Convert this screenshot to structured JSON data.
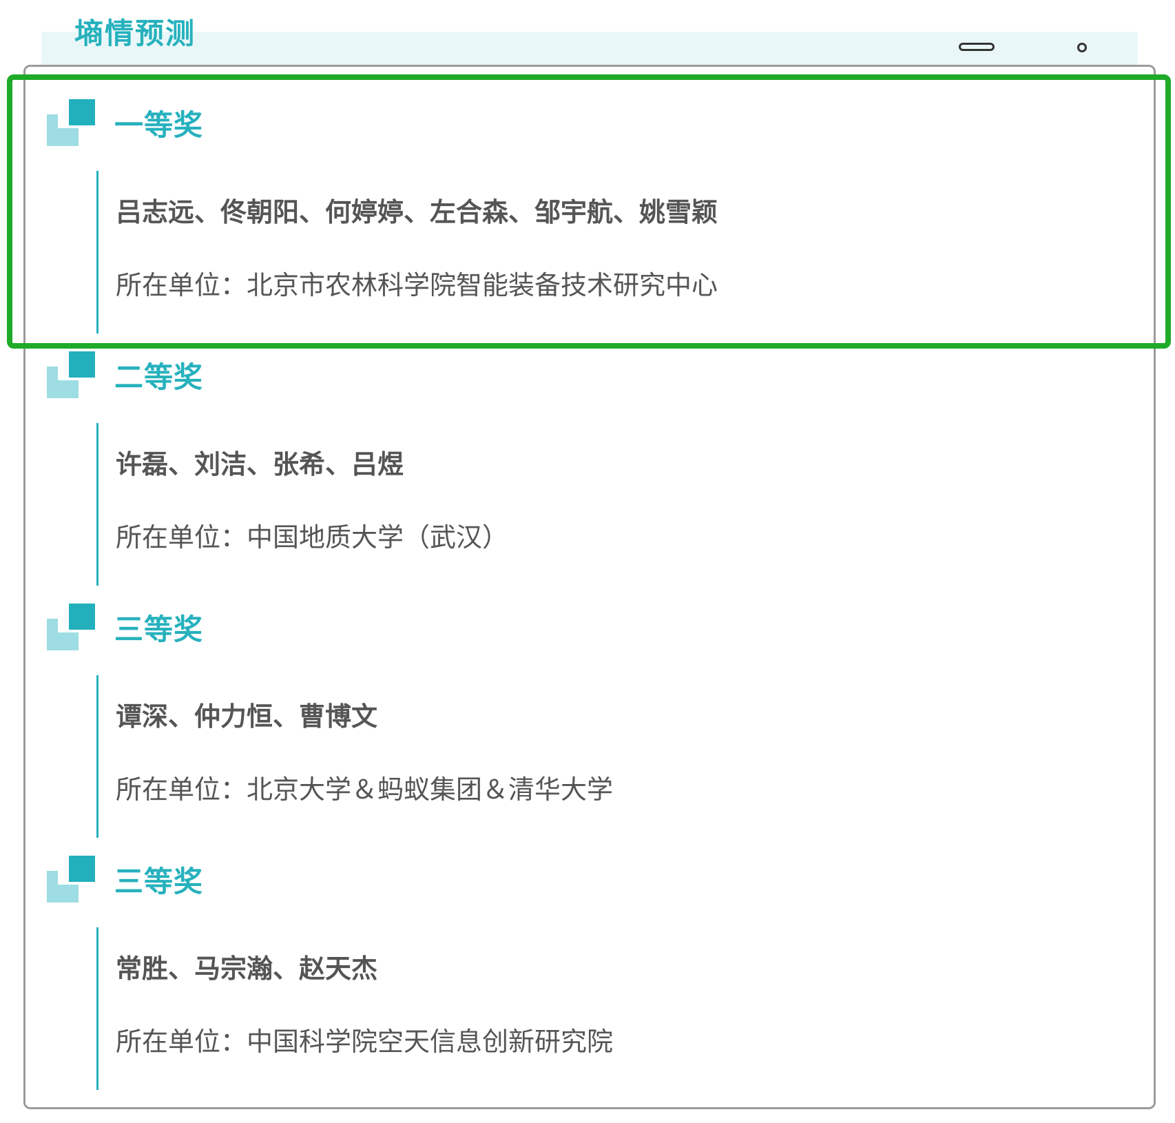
{
  "header": {
    "title": "墒情预测",
    "accent_color": "#26b1bd",
    "icons": [
      "pill-icon",
      "dot-icon"
    ]
  },
  "awards": [
    {
      "title": "一等奖",
      "winners": "吕志远、佟朝阳、何婷婷、左合森、邹宇航、姚雪颖",
      "unit": "所在单位：北京市农林科学院智能装备技术研究中心",
      "highlighted": true
    },
    {
      "title": "二等奖",
      "winners": "许磊、刘洁、张希、吕煜",
      "unit": "所在单位：中国地质大学（武汉）",
      "highlighted": false
    },
    {
      "title": "三等奖",
      "winners": "谭深、仲力恒、曹博文",
      "unit": "所在单位：北京大学＆蚂蚁集团＆清华大学",
      "highlighted": false
    },
    {
      "title": "三等奖",
      "winners": "常胜、马宗瀚、赵天杰",
      "unit": "所在单位：中国科学院空天信息创新研究院",
      "highlighted": false
    }
  ],
  "colors": {
    "accent": "#26b1bd",
    "accent_light": "#9ddde3",
    "text": "#555555",
    "highlight_border": "#1faa2a",
    "card_border": "#9b9b9b",
    "header_band": "#eaf7f8"
  }
}
